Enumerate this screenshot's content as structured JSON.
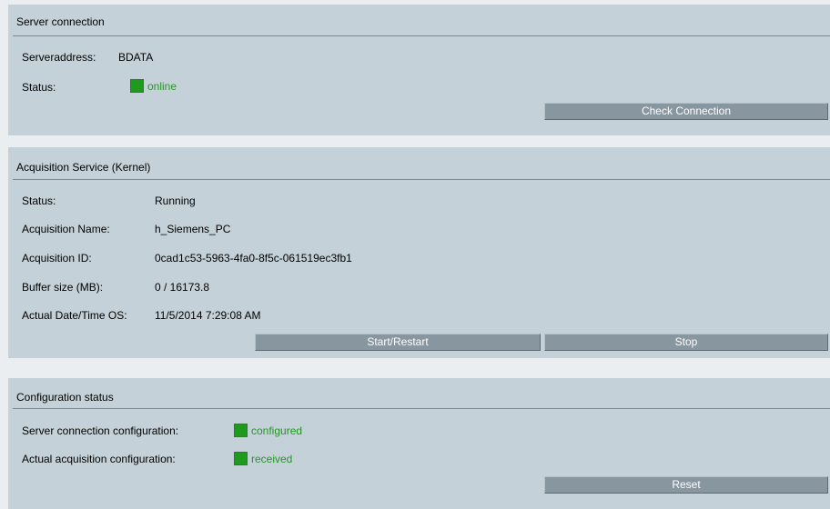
{
  "server_connection": {
    "title": "Server connection",
    "address_label": "Serveraddress:",
    "address_value": "BDATA",
    "status_label": "Status:",
    "status_value": "online",
    "status_color": "#1f9a1f",
    "check_button": "Check Connection"
  },
  "acquisition_service": {
    "title": "Acquisition Service (Kernel)",
    "rows": [
      {
        "label": "Status:",
        "value": "Running"
      },
      {
        "label": "Acquisition Name:",
        "value": "h_Siemens_PC"
      },
      {
        "label": "Acquisition ID:",
        "value": "0cad1c53-5963-4fa0-8f5c-061519ec3fb1"
      },
      {
        "label": "Buffer size (MB):",
        "value": "0 / 16173.8"
      },
      {
        "label": "Actual Date/Time OS:",
        "value": "11/5/2014 7:29:08 AM"
      }
    ],
    "start_button": "Start/Restart",
    "stop_button": "Stop"
  },
  "configuration_status": {
    "title": "Configuration status",
    "server_config_label": "Server connection configuration:",
    "server_config_value": "configured",
    "acquisition_config_label": "Actual acquisition configuration:",
    "acquisition_config_value": "received",
    "indicator_color": "#1f9a1f",
    "reset_button": "Reset"
  }
}
